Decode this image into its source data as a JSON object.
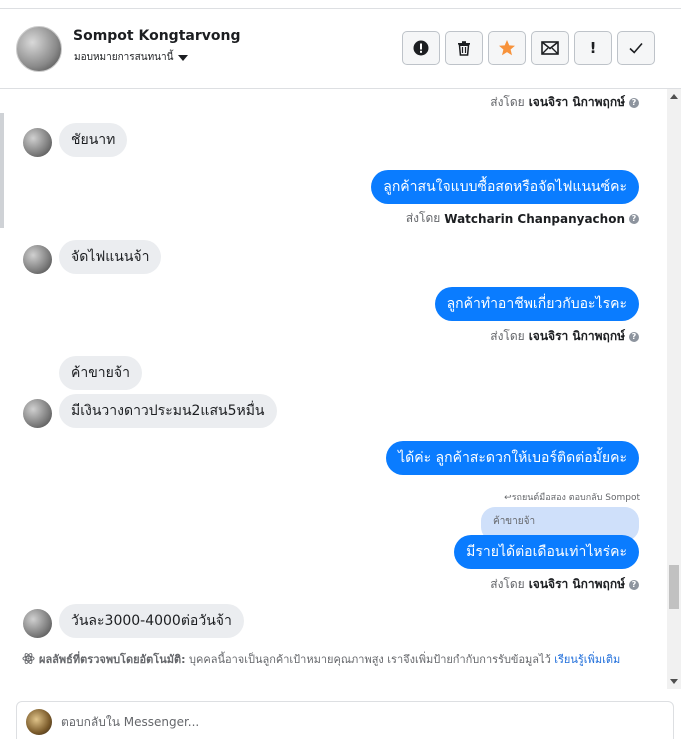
{
  "header": {
    "name": "Sompot Kongtarvong",
    "assign_label": "มอบหมายการสนทนานี้",
    "buttons": {
      "spam": "spam-icon",
      "trash": "trash-icon",
      "star": "star-icon",
      "mail": "mail-icon",
      "important": "!",
      "done": "check-icon"
    },
    "colors": {
      "star": "#f7923b",
      "accent": "#0a7cff"
    }
  },
  "messages": {
    "m0_sentby_prefix": "ส่งโดย",
    "m0_sentby_name": "เจนจิรา นิกาพฤกษ์",
    "m1_text": "ชัยนาท",
    "m2_text": "ลูกค้าสนใจแบบซื้อสดหรือจัดไฟแนนซ์คะ",
    "m2_sentby_prefix": "ส่งโดย",
    "m2_sentby_name": "Watcharin Chanpanyachon",
    "m3_text": "จัดไฟแนนจ้า",
    "m4_text": "ลูกค้าทำอาชีพเกี่ยวกับอะไรคะ",
    "m4_sentby_prefix": "ส่งโดย",
    "m4_sentby_name": "เจนจิรา นิกาพฤกษ์",
    "m5_text": "ค้าขายจ้า",
    "m6_text": "มีเงินวางดาวประมน2แสน5หมื่น",
    "m7_text": "ได้ค่ะ ลูกค้าสะดวกให้เบอร์ติดต่อมั้ยคะ",
    "m8_reply_meta": "↩รถยนต์มือสอง ตอบกลับ Sompot",
    "m8_quoted": "ค้าขายจ้า",
    "m8_text": "มีรายได้ต่อเดือนเท่าไหร่คะ",
    "m8_sentby_prefix": "ส่งโดย",
    "m8_sentby_name": "เจนจิรา นิกาพฤกษ์",
    "m9_text": "วันละ3000-4000ต่อวันจ้า"
  },
  "ai_note": {
    "title": "ผลลัพธ์ที่ตรวจพบโดยอัตโนมัติ:",
    "body": "บุคคลนี้อาจเป็นลูกค้าเป้าหมายคุณภาพสูง เราจึงเพิ่มป้ายกำกับการรับข้อมูลไว้",
    "link": "เรียนรู้เพิ่มเติม"
  },
  "composer": {
    "placeholder": "ตอบกลับใน Messenger..."
  }
}
